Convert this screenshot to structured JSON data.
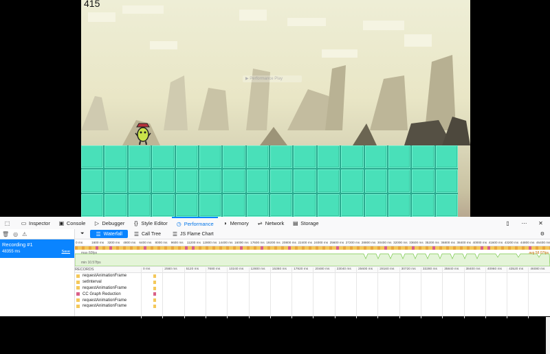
{
  "game": {
    "score": "415",
    "watermark": "▶ Performance Play"
  },
  "colors": {
    "accent": "#0a84ff",
    "tile": "#49e0b9",
    "script_marker": "#f4c85a",
    "gc_marker": "#d96088",
    "fps_line": "#78c84a"
  },
  "toolbar": {
    "tabs": [
      {
        "label": "Inspector",
        "icon": "inspector-icon"
      },
      {
        "label": "Console",
        "icon": "console-icon"
      },
      {
        "label": "Debugger",
        "icon": "debugger-icon"
      },
      {
        "label": "Style Editor",
        "icon": "style-editor-icon"
      },
      {
        "label": "Performance",
        "icon": "performance-icon",
        "active": true
      },
      {
        "label": "Memory",
        "icon": "memory-icon"
      },
      {
        "label": "Network",
        "icon": "network-icon"
      },
      {
        "label": "Storage",
        "icon": "storage-icon"
      }
    ]
  },
  "sidebar": {
    "recording_name": "Recording #1",
    "recording_duration": "48355 ms",
    "save_label": "Save"
  },
  "subtabs": {
    "waterfall": "Waterfall",
    "call_tree": "Call Tree",
    "flame_chart": "JS Flame Chart"
  },
  "overview": {
    "ruler_ticks": [
      "0 ms",
      "1600 ms",
      "3200 ms",
      "4800 ms",
      "6400 ms",
      "8000 ms",
      "9600 ms",
      "11200 ms",
      "12800 ms",
      "14400 ms",
      "16000 ms",
      "17600 ms",
      "19200 ms",
      "20800 ms",
      "22400 ms",
      "24000 ms",
      "25600 ms",
      "27200 ms",
      "28800 ms",
      "30400 ms",
      "32000 ms",
      "33600 ms",
      "35200 ms",
      "36800 ms",
      "38400 ms",
      "40000 ms",
      "41600 ms",
      "43200 ms",
      "44800 ms",
      "46400 ms"
    ],
    "fps_max": "max 60fps",
    "fps_min": "min 10.57fps",
    "fps_avg": "avg 58.07fps"
  },
  "records": {
    "header": "RECORDS",
    "ticks": [
      "0 ms",
      "2560 ms",
      "5120 ms",
      "7680 ms",
      "10240 ms",
      "12800 ms",
      "15360 ms",
      "17920 ms",
      "20480 ms",
      "23040 ms",
      "25600 ms",
      "28160 ms",
      "30720 ms",
      "33280 ms",
      "35840 ms",
      "38400 ms",
      "40960 ms",
      "43520 ms",
      "46080 ms"
    ],
    "rows": [
      {
        "label": "requestAnimationFrame",
        "color": "#f4c85a"
      },
      {
        "label": "setInterval",
        "color": "#f4c85a"
      },
      {
        "label": "requestAnimationFrame",
        "color": "#f4c85a"
      },
      {
        "label": "CC Graph Reduction",
        "color": "#d96088"
      },
      {
        "label": "requestAnimationFrame",
        "color": "#f4c85a"
      },
      {
        "label": "requestAnimationFrame",
        "color": "#f4c85a"
      }
    ]
  }
}
